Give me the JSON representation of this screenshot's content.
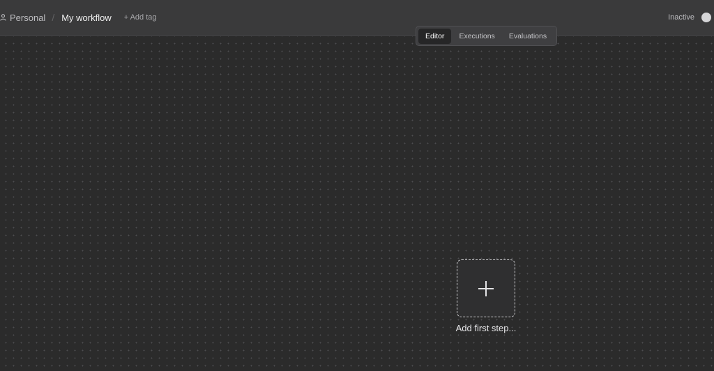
{
  "header": {
    "project": "Personal",
    "separator": "/",
    "workflow_name": "My workflow",
    "add_tag_label": "+ Add tag",
    "status_label": "Inactive",
    "active": false
  },
  "tabs": [
    {
      "label": "Editor",
      "active": true
    },
    {
      "label": "Executions",
      "active": false
    },
    {
      "label": "Evaluations",
      "active": false
    }
  ],
  "canvas": {
    "add_first_step_label": "Add first step..."
  },
  "icons": {
    "project": "user-icon",
    "add_step": "plus-icon"
  },
  "colors": {
    "header_bg": "#3a3a3b",
    "canvas_bg": "#2b2b2b",
    "dot_grid": "#4e4e50"
  }
}
